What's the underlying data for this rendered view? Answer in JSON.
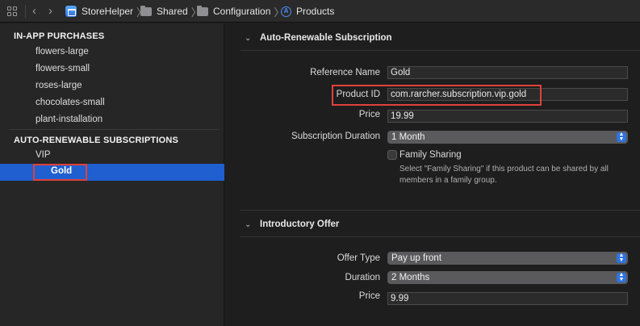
{
  "breadcrumb": [
    "StoreHelper",
    "Shared",
    "Configuration",
    "Products"
  ],
  "nav": {
    "back": "‹",
    "forward": "›"
  },
  "sidebar": {
    "iap_header": "IN-APP PURCHASES",
    "iap_items": [
      "flowers-large",
      "flowers-small",
      "roses-large",
      "chocolates-small",
      "plant-installation"
    ],
    "sub_header": "AUTO-RENEWABLE SUBSCRIPTIONS",
    "sub_items": [
      "VIP",
      "Gold"
    ],
    "selected": "Gold"
  },
  "subscription": {
    "title": "Auto-Renewable Subscription",
    "reference_name_label": "Reference Name",
    "reference_name": "Gold",
    "product_id_label": "Product ID",
    "product_id": "com.rarcher.subscription.vip.gold",
    "price_label": "Price",
    "price": "19.99",
    "duration_label": "Subscription Duration",
    "duration": "1 Month",
    "family_sharing_label": "Family Sharing",
    "family_sharing_checked": false,
    "family_sharing_help": "Select \"Family Sharing\" if this product can be shared by all members in a family group."
  },
  "intro_offer": {
    "title": "Introductory Offer",
    "offer_type_label": "Offer Type",
    "offer_type": "Pay up front",
    "duration_label": "Duration",
    "duration": "2 Months",
    "price_label": "Price",
    "price": "9.99"
  },
  "colors": {
    "accent": "#1f5fd0",
    "highlight": "#e0423a",
    "popup_arrow": "#2f73e0"
  }
}
